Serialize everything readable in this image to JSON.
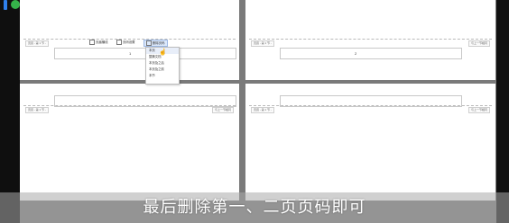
{
  "toolbar": {
    "items": [
      "页眉横线",
      "页码设置",
      "删除页码"
    ]
  },
  "dropdown": {
    "items": [
      "本页",
      "整篇文档",
      "本页及之后",
      "本页及之前",
      "本节"
    ]
  },
  "pages": [
    {
      "header_left": "页眉 - 第 1 节 -",
      "header_right": "",
      "page_number": "1"
    },
    {
      "header_left": "页眉 - 第 1 节 -",
      "header_right": "与上一节相同",
      "page_number": "2"
    },
    {
      "header_left": "页眉 - 第 1 节 -",
      "header_right": "与上一节相同",
      "page_number": ""
    },
    {
      "header_left": "页眉 - 第 1 节 -",
      "header_right": "与上一节相同",
      "page_number": ""
    }
  ],
  "caption": "最后删除第一、二页页码即可",
  "colors": {
    "background": "#7a7a7a",
    "brand_blue": "#2f80ed",
    "brand_green": "#35b24a"
  }
}
